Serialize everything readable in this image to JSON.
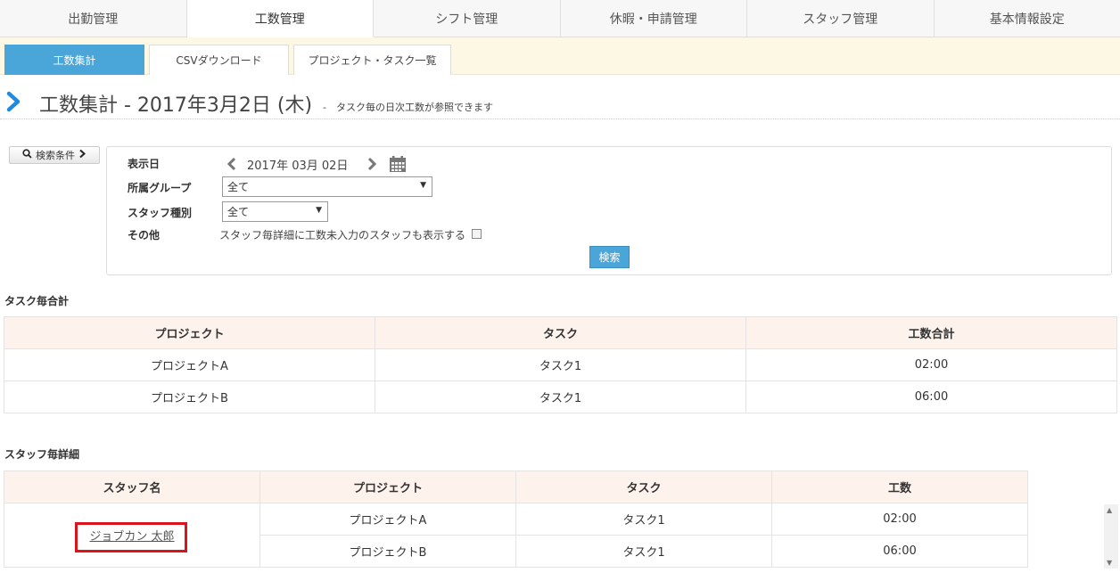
{
  "top_tabs": [
    {
      "label": "出勤管理",
      "active": false
    },
    {
      "label": "工数管理",
      "active": true
    },
    {
      "label": "シフト管理",
      "active": false
    },
    {
      "label": "休暇・申請管理",
      "active": false
    },
    {
      "label": "スタッフ管理",
      "active": false
    },
    {
      "label": "基本情報設定",
      "active": false
    }
  ],
  "sub_tabs": [
    {
      "label": "工数集計",
      "active": true
    },
    {
      "label": "CSVダウンロード",
      "active": false
    },
    {
      "label": "プロジェクト・タスク一覧",
      "active": false
    }
  ],
  "page": {
    "title": "工数集計 - 2017年3月2日 (木)",
    "subtitle": "-　タスク毎の日次工数が参照できます"
  },
  "search": {
    "toggle_label": "検索条件",
    "date_label": "表示日",
    "date_value": "2017年 03月 02日",
    "group_label": "所属グループ",
    "group_value": "全て",
    "staff_type_label": "スタッフ種別",
    "staff_type_value": "全て",
    "other_label": "その他",
    "other_checkbox_label": "スタッフ毎詳細に工数未入力のスタッフも表示する",
    "submit_label": "検索"
  },
  "task_totals": {
    "heading": "タスク毎合計",
    "columns": [
      "プロジェクト",
      "タスク",
      "工数合計"
    ],
    "rows": [
      [
        "プロジェクトA",
        "タスク1",
        "02:00"
      ],
      [
        "プロジェクトB",
        "タスク1",
        "06:00"
      ]
    ]
  },
  "staff_details": {
    "heading": "スタッフ毎詳細",
    "columns": [
      "スタッフ名",
      "プロジェクト",
      "タスク",
      "工数"
    ],
    "staff_name": "ジョブカン 太郎",
    "rows": [
      [
        "プロジェクトA",
        "タスク1",
        "02:00"
      ],
      [
        "プロジェクトB",
        "タスク1",
        "06:00"
      ]
    ]
  },
  "colors": {
    "accent_blue": "#4aa6d9",
    "header_bg": "#fdf3ec",
    "subnav_bg": "#fdf8e4",
    "highlight_red": "#d9141a"
  }
}
